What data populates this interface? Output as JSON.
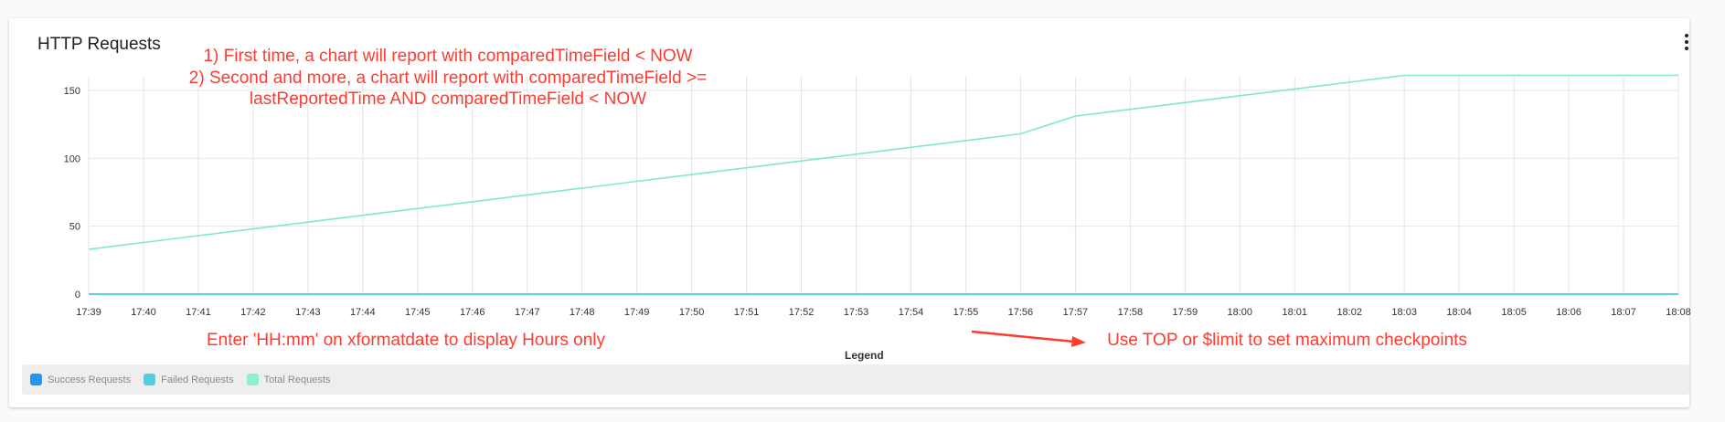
{
  "card": {
    "title": "HTTP Requests"
  },
  "annotations": {
    "top_lines": [
      "1) First time, a chart will report with comparedTimeField < NOW",
      "2) Second and more, a chart will report with comparedTimeField >=",
      "lastReportedTime AND comparedTimeField < NOW"
    ],
    "bottom_left": "Enter 'HH:mm' on xformatdate to display Hours only",
    "bottom_right": "Use TOP or $limit to set maximum checkpoints",
    "color": "#ff3b30"
  },
  "legend": {
    "title": "Legend",
    "items": [
      {
        "label": "Success Requests",
        "color": "#2196f3"
      },
      {
        "label": "Failed Requests",
        "color": "#4dd0e1"
      },
      {
        "label": "Total Requests",
        "color": "#8ef0c8"
      }
    ]
  },
  "chart_data": {
    "type": "line",
    "title": "HTTP Requests",
    "xlabel": "",
    "ylabel": "",
    "ylim": [
      0,
      160
    ],
    "yticks": [
      0,
      50,
      100,
      150
    ],
    "grid": true,
    "legend_position": "bottom",
    "x": [
      "17:39",
      "17:40",
      "17:41",
      "17:42",
      "17:43",
      "17:44",
      "17:45",
      "17:46",
      "17:47",
      "17:48",
      "17:49",
      "17:50",
      "17:51",
      "17:52",
      "17:53",
      "17:54",
      "17:55",
      "17:56",
      "17:57",
      "17:58",
      "17:59",
      "18:00",
      "18:01",
      "18:02",
      "18:03",
      "18:04",
      "18:05",
      "18:06",
      "18:07",
      "18:08"
    ],
    "series": [
      {
        "name": "Success Requests",
        "color": "#2196f3",
        "values": [
          0,
          0,
          0,
          0,
          0,
          0,
          0,
          0,
          0,
          0,
          0,
          0,
          0,
          0,
          0,
          0,
          0,
          0,
          0,
          0,
          0,
          0,
          0,
          0,
          0,
          0,
          0,
          0,
          0,
          0
        ]
      },
      {
        "name": "Failed Requests",
        "color": "#4dd0e1",
        "values": [
          0,
          0,
          0,
          0,
          0,
          0,
          0,
          0,
          0,
          0,
          0,
          0,
          0,
          0,
          0,
          0,
          0,
          0,
          0,
          0,
          0,
          0,
          0,
          0,
          0,
          0,
          0,
          0,
          0,
          0
        ]
      },
      {
        "name": "Total Requests",
        "color": "#7fe8cf",
        "values": [
          33,
          38,
          43,
          48,
          53,
          58,
          63,
          68,
          73,
          78,
          83,
          88,
          93,
          98,
          103,
          108,
          113,
          118,
          131,
          136,
          141,
          146,
          151,
          156,
          161,
          161,
          161,
          161,
          161,
          161
        ]
      }
    ]
  }
}
